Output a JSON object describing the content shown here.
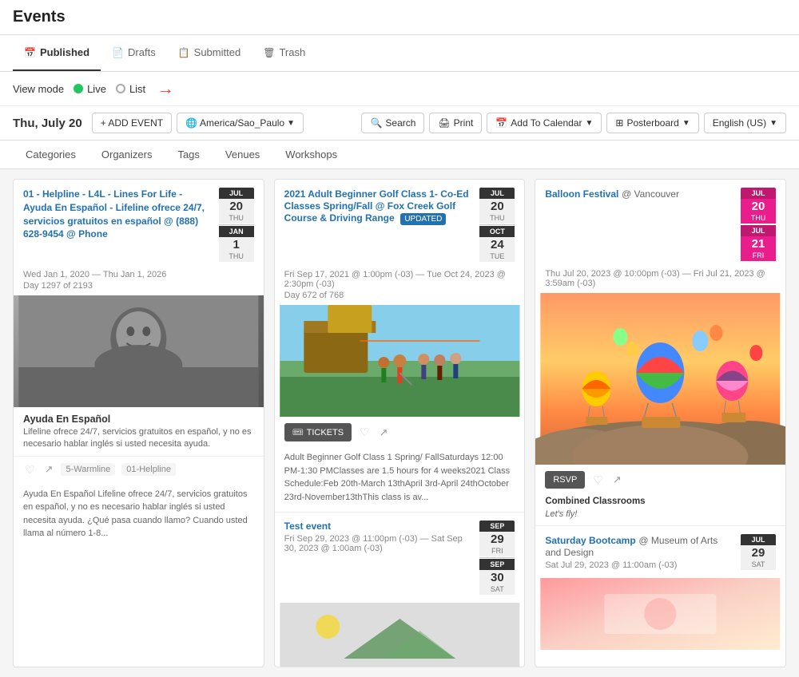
{
  "page": {
    "title": "Events"
  },
  "tabs": [
    {
      "id": "published",
      "label": "Published",
      "icon": "📅",
      "active": true
    },
    {
      "id": "drafts",
      "label": "Drafts",
      "icon": "📄",
      "active": false
    },
    {
      "id": "submitted",
      "label": "Submitted",
      "icon": "📋",
      "active": false
    },
    {
      "id": "trash",
      "label": "Trash",
      "icon": "🗑",
      "active": false
    }
  ],
  "viewMode": {
    "label": "View mode",
    "options": [
      {
        "id": "live",
        "label": "Live",
        "active": true
      },
      {
        "id": "list",
        "label": "List",
        "active": false
      }
    ]
  },
  "toolbar": {
    "dateLabel": "Thu, July 20",
    "addEventLabel": "+ ADD EVENT",
    "timezone": "America/Sao_Paulo",
    "searchLabel": "Search",
    "printLabel": "Print",
    "calendarLabel": "Add To Calendar",
    "posterboardLabel": "Posterboard",
    "languageLabel": "English (US)"
  },
  "filterTabs": [
    {
      "id": "categories",
      "label": "Categories"
    },
    {
      "id": "organizers",
      "label": "Organizers"
    },
    {
      "id": "tags",
      "label": "Tags"
    },
    {
      "id": "venues",
      "label": "Venues"
    },
    {
      "id": "workshops",
      "label": "Workshops"
    }
  ],
  "events": [
    {
      "id": "event1",
      "title": "01 - Helpline - L4L - Lines For Life - Ayuda En Español - Lifeline ofrece 24/7, servicios gratuitos en español @ (888) 628-9454 @ Phone",
      "dateRange": "Wed Jan 1, 2020 — Thu Jan 1, 2026",
      "dayCount": "Day 1297 of 2193",
      "badge": {
        "month1": "JUL",
        "day1": "20",
        "dow1": "THU",
        "month2": "JAN",
        "day2": "1",
        "dow2": "THU"
      },
      "imagePlaceholder": "bw-face",
      "captionTitle": "Ayuda En Español",
      "captionSub": "Lifeline ofrece 24/7, servicios gratuitos en español, y no es necesario hablar inglés si usted necesita ayuda.",
      "tags": [
        "5-Warmline",
        "01-Helpline"
      ],
      "description": "Ayuda En Español Lifeline ofrece 24/7, servicios gratuitos en español, y no es necesario hablar inglés si usted necesita ayuda. ¿Qué pasa cuando llamo? Cuando usted llama al número 1-8..."
    },
    {
      "id": "event2",
      "title": "2021 Adult Beginner Golf Class 1- Co-Ed Classes Spring/Fall @ Fox Creek Golf Course & Driving Range",
      "updatedBadge": "UPDATED",
      "dateRange": "Fri Sep 17, 2021 @ 1:00pm (-03) — Tue Oct 24, 2023 @ 2:30pm (-03)",
      "dayCount": "Day 672 of 768",
      "badge": {
        "month1": "JUL",
        "day1": "20",
        "dow1": "THU",
        "month2": "OCT",
        "day2": "24",
        "dow2": "TUE"
      },
      "imageType": "golf",
      "ticketBtn": "TICKETS",
      "description": "Adult Beginner Golf Class 1 Spring/ FallSaturdays 12:00 PM-1:30 PMClasses are 1.5 hours for 4 weeks2021 Class Schedule:Feb 20th-March 13thApril 3rd-April 24thOctober 23rd-November13thThis class is av..."
    },
    {
      "id": "event3",
      "title": "Balloon Festival @ Vancouver",
      "dateRange": "Thu Jul 20, 2023 @ 10:00pm (-03) — Fri Jul 21, 2023 @ 3:59am (-03)",
      "badge": {
        "month1": "JUL",
        "day1": "20",
        "dow1": "THU",
        "month2": "JUL",
        "day2": "21",
        "dow2": "FRI"
      },
      "imageType": "balloon",
      "rsvpBtn": "RSVP",
      "venueName": "Combined Classrooms",
      "venueTagline": "Let's fly!"
    },
    {
      "id": "event4",
      "title": "Test event",
      "dateRange": "Fri Sep 29, 2023 @ 11:00pm (-03) — Sat Sep 30, 2023 @ 1:00am (-03)",
      "badge": {
        "month1": "SEP",
        "day1": "29",
        "dow1": "FRI",
        "month2": "SEP",
        "day2": "30",
        "dow2": "SAT"
      },
      "imageType": "green"
    },
    {
      "id": "event5",
      "title": "Saturday Bootcamp @ Museum of Arts and Design",
      "dateRange": "Sat Jul 29, 2023 @ 11:00am (-03)",
      "badge": {
        "month1": "JUL",
        "day1": "29",
        "dow1": "SAT"
      },
      "imageType": "pink"
    }
  ]
}
